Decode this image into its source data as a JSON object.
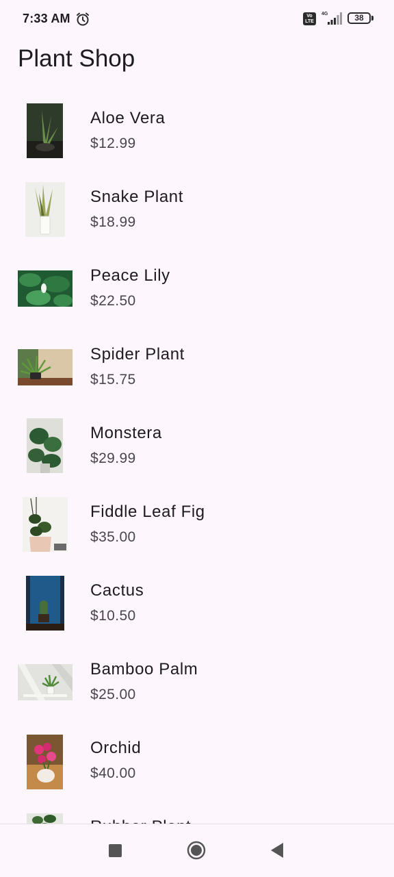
{
  "status_bar": {
    "time": "7:33 AM",
    "volte_top": "Vo",
    "volte_bottom": "LTE",
    "network": "4G",
    "battery": "38",
    "icons": [
      "alarm-icon",
      "volte-icon",
      "signal-icon",
      "battery-icon"
    ]
  },
  "app": {
    "title": "Plant Shop"
  },
  "plants": [
    {
      "name": "Aloe Vera",
      "price": "$12.99"
    },
    {
      "name": "Snake Plant",
      "price": "$18.99"
    },
    {
      "name": "Peace Lily",
      "price": "$22.50"
    },
    {
      "name": "Spider Plant",
      "price": "$15.75"
    },
    {
      "name": "Monstera",
      "price": "$29.99"
    },
    {
      "name": "Fiddle Leaf Fig",
      "price": "$35.00"
    },
    {
      "name": "Cactus",
      "price": "$10.50"
    },
    {
      "name": "Bamboo Palm",
      "price": "$25.00"
    },
    {
      "name": "Orchid",
      "price": "$40.00"
    },
    {
      "name": "Rubber Plant",
      "price": ""
    }
  ],
  "nav_bar": {
    "icons": [
      "recents-icon",
      "home-icon",
      "back-icon"
    ]
  }
}
